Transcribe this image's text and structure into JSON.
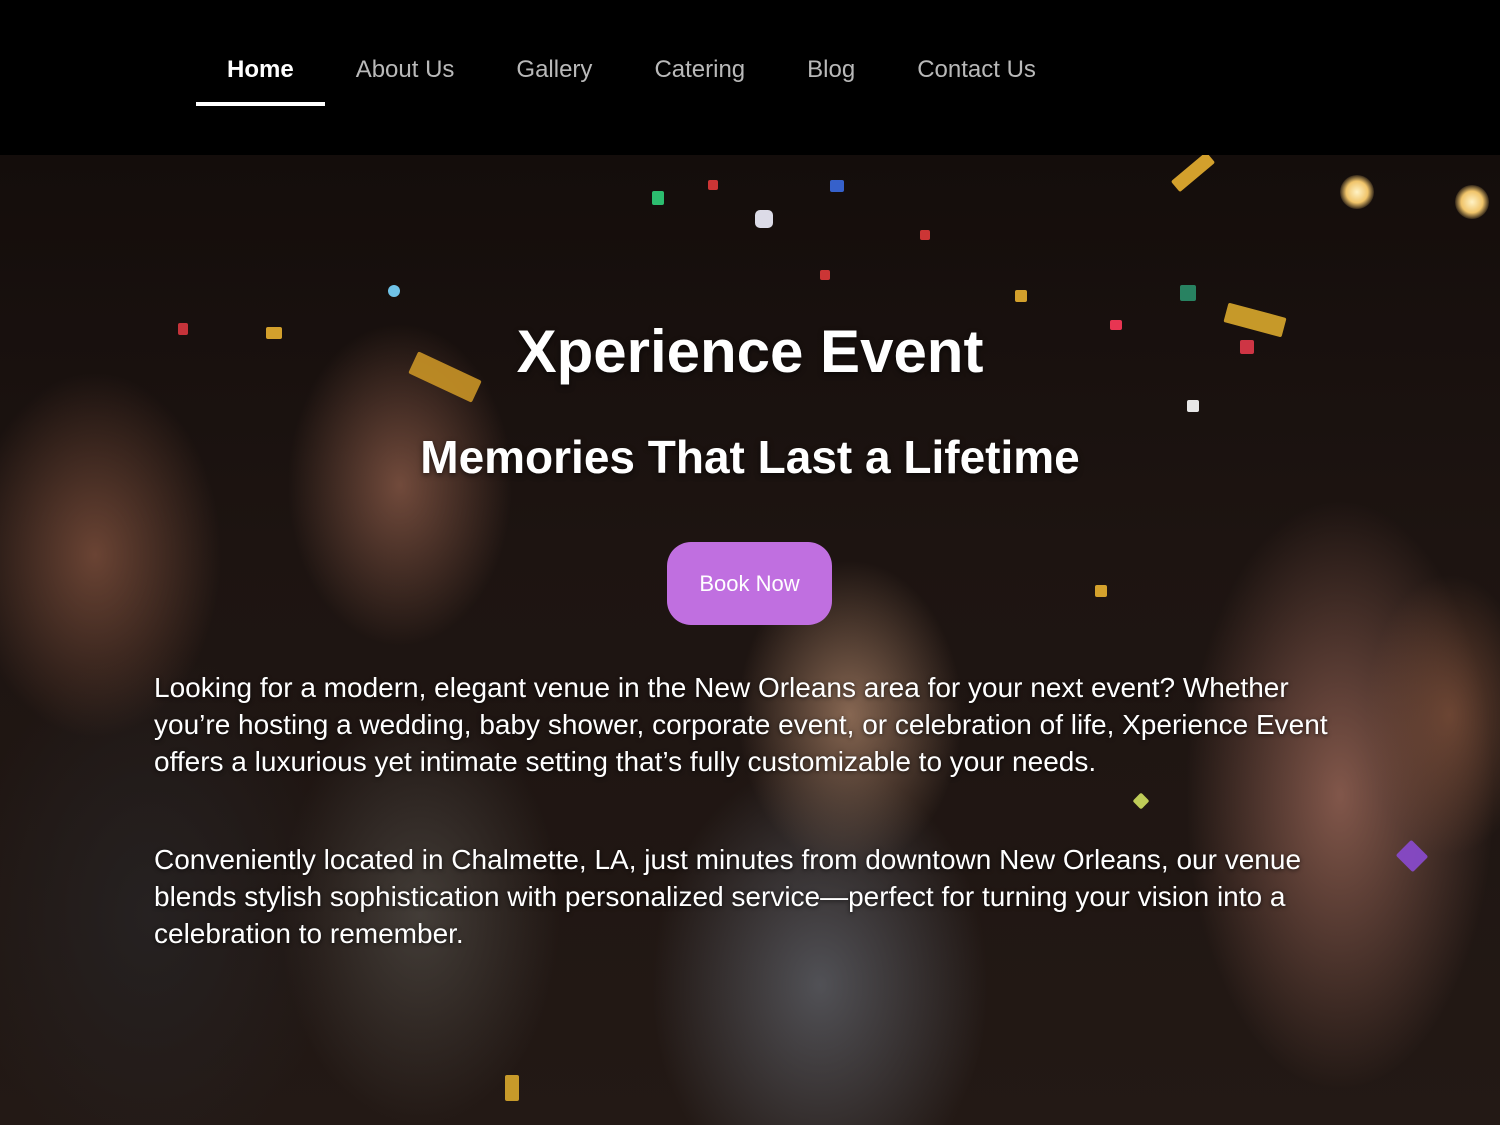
{
  "nav": {
    "items": [
      {
        "label": "Home",
        "active": true
      },
      {
        "label": "About Us",
        "active": false
      },
      {
        "label": "Gallery",
        "active": false
      },
      {
        "label": "Catering",
        "active": false
      },
      {
        "label": "Blog",
        "active": false
      },
      {
        "label": "Contact Us",
        "active": false
      }
    ]
  },
  "hero": {
    "title": "Xperience Event",
    "subtitle": "Memories That Last a Lifetime",
    "cta_label": "Book Now",
    "paragraphs": [
      "Looking for a modern, elegant venue in the New Orleans area for your next event? Whether you’re hosting a wedding, baby shower, corporate event, or celebration of life, Xperience Event offers a luxurious yet intimate setting that’s fully customizable to your needs.",
      "Conveniently located in Chalmette, LA, just minutes from downtown New Orleans, our venue blends stylish sophistication with personalized service—perfect for turning your vision into a celebration to remember."
    ]
  },
  "colors": {
    "nav_background": "#000000",
    "nav_active": "#ffffff",
    "nav_inactive": "#b9b9b9",
    "cta_background": "#c06fe0"
  }
}
